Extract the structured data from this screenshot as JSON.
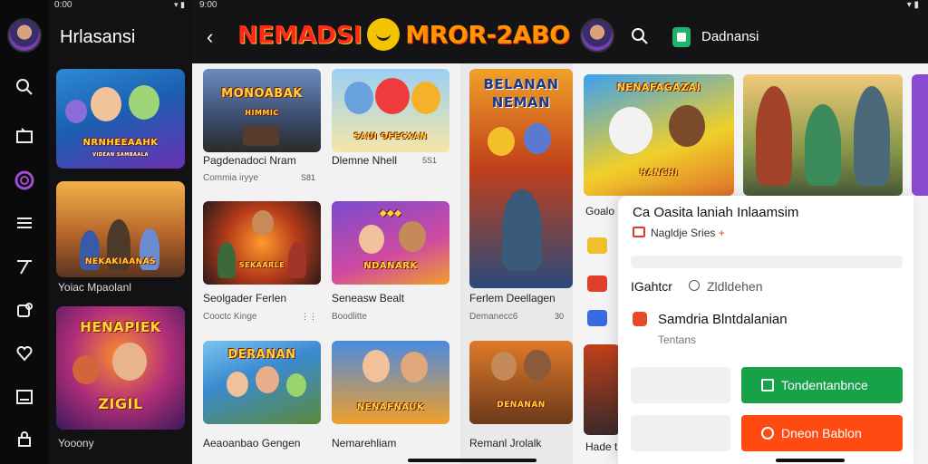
{
  "panel_left": {
    "status_time": "0:00",
    "title": "Hrlasansi",
    "rail_icons": [
      "search-icon",
      "tv-icon",
      "spiral-icon",
      "menu-icon",
      "filter-icon",
      "puzzle-icon",
      "heart-icon",
      "image-icon",
      "lock-icon"
    ],
    "cards": [
      {
        "banner": "NRNHEEAAHK",
        "caption": "",
        "sub": ""
      },
      {
        "banner": "NEKAKIAANAS",
        "caption": "Yoiac Mpaolanl",
        "sub": ""
      },
      {
        "banner": "HENAPIEK",
        "banner2": "ZIGIL",
        "caption": "Yooony",
        "sub": ""
      }
    ],
    "card_sub_1": "VIDEAN SAMBAALA"
  },
  "panel_mid": {
    "status_time": "9:00",
    "logo_left": "NEMADSI",
    "logo_right": "MROR-2ABO",
    "tiles": [
      {
        "banner": "MONOABAK",
        "banner2": "HIMMIC",
        "title": "Pagdenadoci Nram",
        "sub": "Commia iryye",
        "meta": "S81"
      },
      {
        "banner": "SAUI OFECXAN",
        "title": "Dlemne Nhell",
        "sub": "",
        "meta": "5S1"
      },
      {
        "banner": "SEKAARLE",
        "title": "Seolgader Ferlen",
        "sub": "Cooctc Kinge",
        "meta": ""
      },
      {
        "banner": "NDANARK",
        "title": "Seneasw Bealt",
        "sub": "Boodlitte",
        "meta": ""
      },
      {
        "banner": "DERANAN",
        "title": "Aeaoanbao Gengen",
        "sub": "",
        "meta": ""
      },
      {
        "banner": "NENAFNAUK",
        "title": "Nemarehliam",
        "sub": "",
        "meta": ""
      }
    ],
    "mid_col": [
      {
        "banner": "BELANAN",
        "banner2": "NEMAN",
        "title": "Ferlem Deellagen",
        "sub": "Demanecc6",
        "meta": "30"
      },
      {
        "banner": "DENANAN",
        "title": "Remanl Jrolalk",
        "sub": "",
        "meta": ""
      }
    ]
  },
  "panel_right": {
    "title": "Dadnansi",
    "cards": [
      {
        "banner": "NENAFAGAZAI",
        "banner2": "HANCHI"
      },
      {
        "banner": ""
      }
    ],
    "side_items": [
      "Goalo",
      "",
      "",
      ""
    ],
    "side_last": "Hade t",
    "sheet": {
      "title": "Ca  Oasita laniah Inlaamsim",
      "subtitle": "Nagldje Sries",
      "plus": "+",
      "label": "IGahtcr",
      "radio_label": "Zldldehen",
      "option_title": "Samdria Blntdalanian",
      "option_sub": "Tentans",
      "btn_primary": "Tondentanbnce",
      "btn_secondary": "Dneon Bablon"
    }
  },
  "colors": {
    "accent_purple": "#a14bd6",
    "green": "#17a24a",
    "orange": "#ff4a12",
    "logo_red": "#ff2a1a",
    "logo_orange": "#ff9500"
  }
}
